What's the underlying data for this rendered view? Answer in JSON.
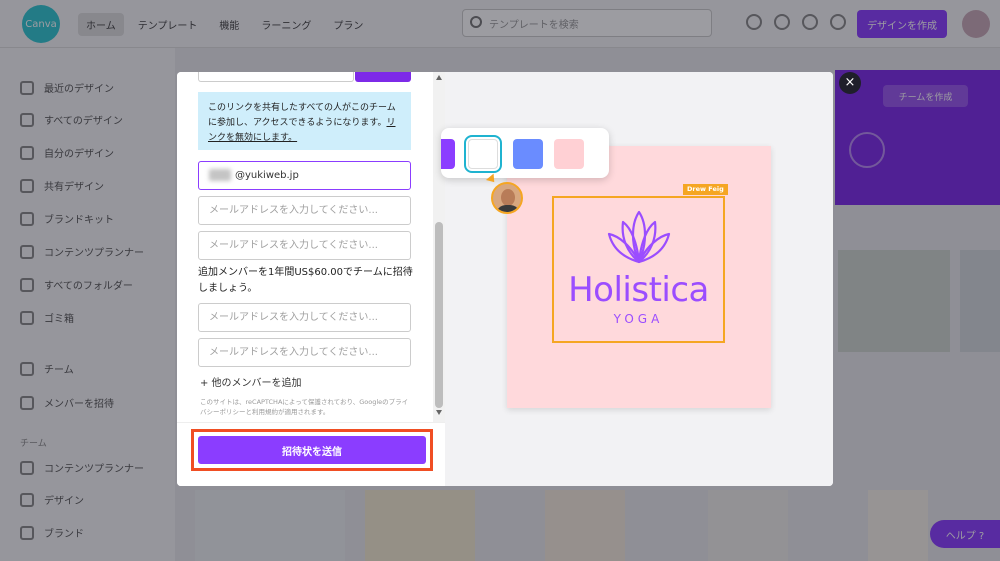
{
  "app": {
    "logo_text": "Canva",
    "nav": [
      "ホーム",
      "テンプレート",
      "機能",
      "ラーニング",
      "プラン"
    ],
    "search_placeholder": "テンプレートを検索",
    "create_label": "デザインを作成",
    "help_label": "ヘルプ ?"
  },
  "sidebar": {
    "items": [
      "最近のデザイン",
      "すべてのデザイン",
      "自分のデザイン",
      "共有デザイン",
      "ブランドキット",
      "コンテンツプランナー",
      "すべてのフォルダー",
      "ゴミ箱"
    ],
    "team_items": [
      "チーム",
      "メンバーを招待"
    ],
    "section_label": "チーム",
    "bottom_items": [
      "コンテンツプランナー",
      "デザイン",
      "ブランド"
    ]
  },
  "banner": {
    "pill": "チームを作成"
  },
  "modal": {
    "close_label": "×",
    "notice": {
      "text": "このリンクを共有したすべての人がこのチームに参加し、アクセスできるようになります。",
      "link": "リンクを無効にします。"
    },
    "email_filled_value": "@yukiweb.jp",
    "email_placeholder": "メールアドレスを入力してください...",
    "invite_text": "追加メンバーを1年間US$60.00でチームに招待しましょう。",
    "add_member_label": "+ 他のメンバーを追加",
    "recaptcha": "このサイトは、reCAPTCHAによって保護されており、Googleのプライバシーポリシーと利用規約が適用されます。",
    "send_button": "招待状を送信"
  },
  "preview": {
    "collaborator_name": "Drew Feig",
    "brand_name": "Holistica",
    "brand_sub": "YOGA",
    "swatches": [
      "#8b3dff",
      "#ffffff",
      "#6a8cff",
      "#ffd0d4"
    ],
    "card_color": "#ffd9dc",
    "frame_color": "#f5a623",
    "brand_color": "#9b4dff"
  }
}
